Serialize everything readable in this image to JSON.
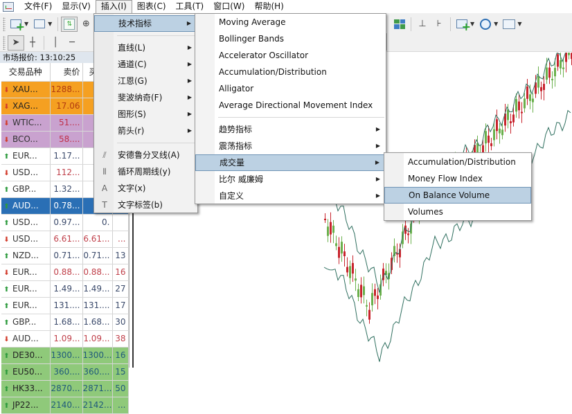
{
  "menubar": {
    "items": [
      {
        "label": "文件(F)"
      },
      {
        "label": "显示(V)"
      },
      {
        "label": "插入(I)",
        "active": true
      },
      {
        "label": "图表(C)"
      },
      {
        "label": "工具(T)"
      },
      {
        "label": "窗口(W)"
      },
      {
        "label": "帮助(H)"
      }
    ]
  },
  "toolbar": {
    "row1": [
      "new-chart-icon",
      "profiles-icon",
      "market-watch-icon",
      "crosshair-icon"
    ],
    "row2": [
      "cursor-icon",
      "crosshair-icon",
      "vertical-line-icon",
      "horizontal-line-icon"
    ],
    "right": [
      "tile-windows-icon",
      "chart-shift-icon",
      "auto-scroll-icon",
      "indicators-icon",
      "periods-icon",
      "templates-icon"
    ]
  },
  "market_watch": {
    "title": "市场报价: 13:10:25",
    "columns": [
      "交易品种",
      "卖价",
      "买价",
      ""
    ],
    "rows": [
      {
        "symbol": "XAU...",
        "bid": "1288...",
        "ask": "12",
        "spread": "",
        "dir": "down",
        "style": "orange"
      },
      {
        "symbol": "XAG...",
        "bid": "17.06",
        "ask": "1",
        "spread": "",
        "dir": "down",
        "style": "orange"
      },
      {
        "symbol": "WTIC...",
        "bid": "51....",
        "ask": "",
        "spread": "",
        "dir": "down",
        "style": "purple"
      },
      {
        "symbol": "BCO...",
        "bid": "58....",
        "ask": "",
        "spread": "",
        "dir": "down",
        "style": "purple"
      },
      {
        "symbol": "EUR...",
        "bid": "1.17...",
        "ask": "1.",
        "spread": "",
        "dir": "up",
        "style": "white-up"
      },
      {
        "symbol": "USD...",
        "bid": "112...",
        "ask": "11",
        "spread": "",
        "dir": "down",
        "style": "white-down"
      },
      {
        "symbol": "GBP...",
        "bid": "1.32...",
        "ask": "1.",
        "spread": "",
        "dir": "up",
        "style": "white-up"
      },
      {
        "symbol": "AUD...",
        "bid": "0.78...",
        "ask": "0.",
        "spread": "",
        "dir": "up",
        "style": "selected"
      },
      {
        "symbol": "USD...",
        "bid": "0.97...",
        "ask": "0.",
        "spread": "",
        "dir": "up",
        "style": "white-up"
      },
      {
        "symbol": "USD...",
        "bid": "6.61...",
        "ask": "6.61...",
        "spread": "...",
        "dir": "down",
        "style": "white-down"
      },
      {
        "symbol": "NZD...",
        "bid": "0.71...",
        "ask": "0.71...",
        "spread": "13",
        "dir": "up",
        "style": "white-up"
      },
      {
        "symbol": "EUR...",
        "bid": "0.88...",
        "ask": "0.88...",
        "spread": "16",
        "dir": "down",
        "style": "white-down"
      },
      {
        "symbol": "EUR...",
        "bid": "1.49...",
        "ask": "1.49...",
        "spread": "27",
        "dir": "up",
        "style": "white-up"
      },
      {
        "symbol": "EUR...",
        "bid": "131....",
        "ask": "131....",
        "spread": "17",
        "dir": "up",
        "style": "white-up"
      },
      {
        "symbol": "GBP...",
        "bid": "1.68...",
        "ask": "1.68...",
        "spread": "30",
        "dir": "up",
        "style": "white-up"
      },
      {
        "symbol": "AUD...",
        "bid": "1.09...",
        "ask": "1.09...",
        "spread": "38",
        "dir": "down",
        "style": "white-down"
      },
      {
        "symbol": "DE30...",
        "bid": "1300...",
        "ask": "1300...",
        "spread": "16",
        "dir": "up",
        "style": "green"
      },
      {
        "symbol": "EU50...",
        "bid": "360....",
        "ask": "360....",
        "spread": "15",
        "dir": "up",
        "style": "green"
      },
      {
        "symbol": "HK33...",
        "bid": "2870...",
        "ask": "2871...",
        "spread": "50",
        "dir": "up",
        "style": "green"
      },
      {
        "symbol": "JP22...",
        "bid": "2140...",
        "ask": "2142...",
        "spread": "...",
        "dir": "up",
        "style": "green"
      }
    ]
  },
  "insert_menu": {
    "items": [
      {
        "label": "技术指标",
        "submenu": true,
        "highlighted": true
      },
      {
        "separator": true
      },
      {
        "label": "直线(L)",
        "submenu": true
      },
      {
        "label": "通道(C)",
        "submenu": true
      },
      {
        "label": "江恩(G)",
        "submenu": true
      },
      {
        "label": "斐波纳奇(F)",
        "submenu": true
      },
      {
        "label": "图形(S)",
        "submenu": true
      },
      {
        "label": "箭头(r)",
        "submenu": true
      },
      {
        "separator": true
      },
      {
        "label": "安德鲁分叉线(A)",
        "icon": "andrews-pitchfork-icon",
        "glyph": "⫽"
      },
      {
        "label": "循环周期线(y)",
        "icon": "cycle-lines-icon",
        "glyph": "⦀"
      },
      {
        "label": "文字(x)",
        "icon": "text-icon",
        "glyph": "A"
      },
      {
        "label": "文字标签(b)",
        "icon": "text-label-icon",
        "glyph": "T"
      }
    ]
  },
  "indicators_menu": {
    "items": [
      {
        "label": "Moving Average"
      },
      {
        "label": "Bollinger Bands"
      },
      {
        "label": "Accelerator Oscillator"
      },
      {
        "label": "Accumulation/Distribution"
      },
      {
        "label": "Alligator"
      },
      {
        "label": "Average Directional Movement Index"
      },
      {
        "separator": true
      },
      {
        "label": "趋势指标",
        "submenu": true
      },
      {
        "label": "震荡指标",
        "submenu": true
      },
      {
        "label": "成交量",
        "submenu": true,
        "highlighted": true
      },
      {
        "label": "比尔 威廉姆",
        "submenu": true
      },
      {
        "label": "自定义",
        "submenu": true
      }
    ]
  },
  "volumes_menu": {
    "items": [
      {
        "label": "Accumulation/Distribution"
      },
      {
        "label": "Money Flow Index"
      },
      {
        "label": "On Balance Volume",
        "highlighted": true
      },
      {
        "label": "Volumes"
      }
    ]
  },
  "chart": {
    "bull_color": "#6ab04c",
    "bear_color": "#c8232c",
    "band_color": "#2f6f5f"
  }
}
